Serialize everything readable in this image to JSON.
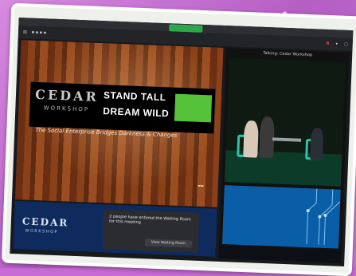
{
  "slide": {
    "brand": "CEDAR",
    "brand_sub": "WORKSHOP",
    "tagline_line1": "STAND TALL",
    "tagline_line2": "DREAM WILD",
    "subtitle": "The Social Enterprise Bridges Darkness & Changes"
  },
  "gallery": {
    "speaker_name": "Talking: Cedar Workshop"
  },
  "waiting_room": {
    "message": "2 people have entered the Waiting Room for this meeting",
    "button_label": "View Waiting Room"
  },
  "lower_brand": {
    "brand": "CEDAR",
    "brand_sub": "WORKSHOP"
  },
  "colors": {
    "background": "#c86bd6",
    "slide_accent": "#55c23a",
    "chair": "#28c7a7",
    "blue_pane": "#0a5ea8"
  }
}
